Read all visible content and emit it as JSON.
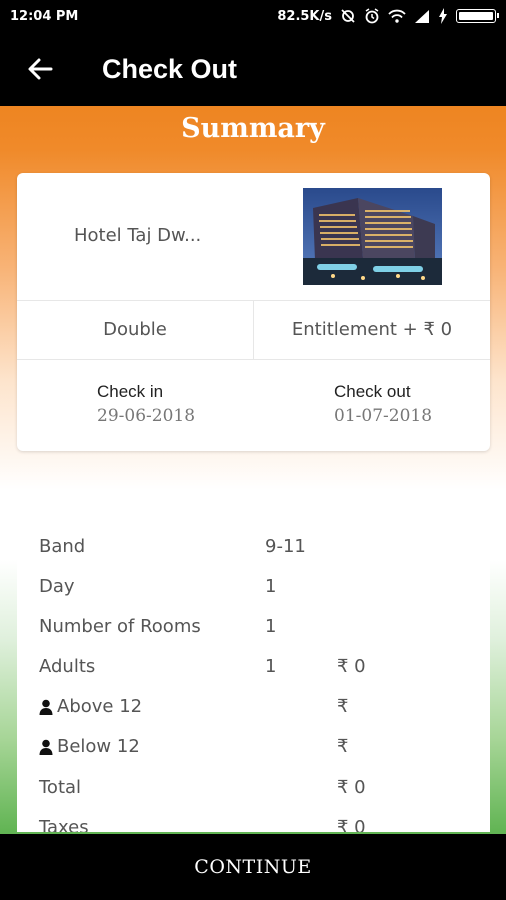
{
  "status": {
    "time": "12:04 PM",
    "speed": "82.5K/s"
  },
  "appbar": {
    "title": "Check Out"
  },
  "summary": {
    "title": "Summary"
  },
  "card": {
    "hotel_name": "Hotel Taj Dw...",
    "room_type": "Double",
    "entitlement": "Entitlement + ₹ 0",
    "check_in_label": "Check in",
    "check_in_date": "29-06-2018",
    "check_out_label": "Check out",
    "check_out_date": "01-07-2018"
  },
  "details": {
    "rows": [
      {
        "label": "Band",
        "value": "9-11",
        "amount": ""
      },
      {
        "label": "Day",
        "value": "1",
        "amount": ""
      },
      {
        "label": "Number of Rooms",
        "value": "1",
        "amount": ""
      },
      {
        "label": "Adults",
        "value": "1",
        "amount": "₹ 0"
      },
      {
        "label": "Above 12",
        "value": "",
        "amount": "₹"
      },
      {
        "label": "Below 12",
        "value": "",
        "amount": "₹"
      },
      {
        "label": "Total",
        "value": "",
        "amount": "₹ 0"
      },
      {
        "label": "Taxes",
        "value": "",
        "amount": "₹ 0"
      }
    ]
  },
  "footer": {
    "continue_label": "CONTINUE"
  }
}
